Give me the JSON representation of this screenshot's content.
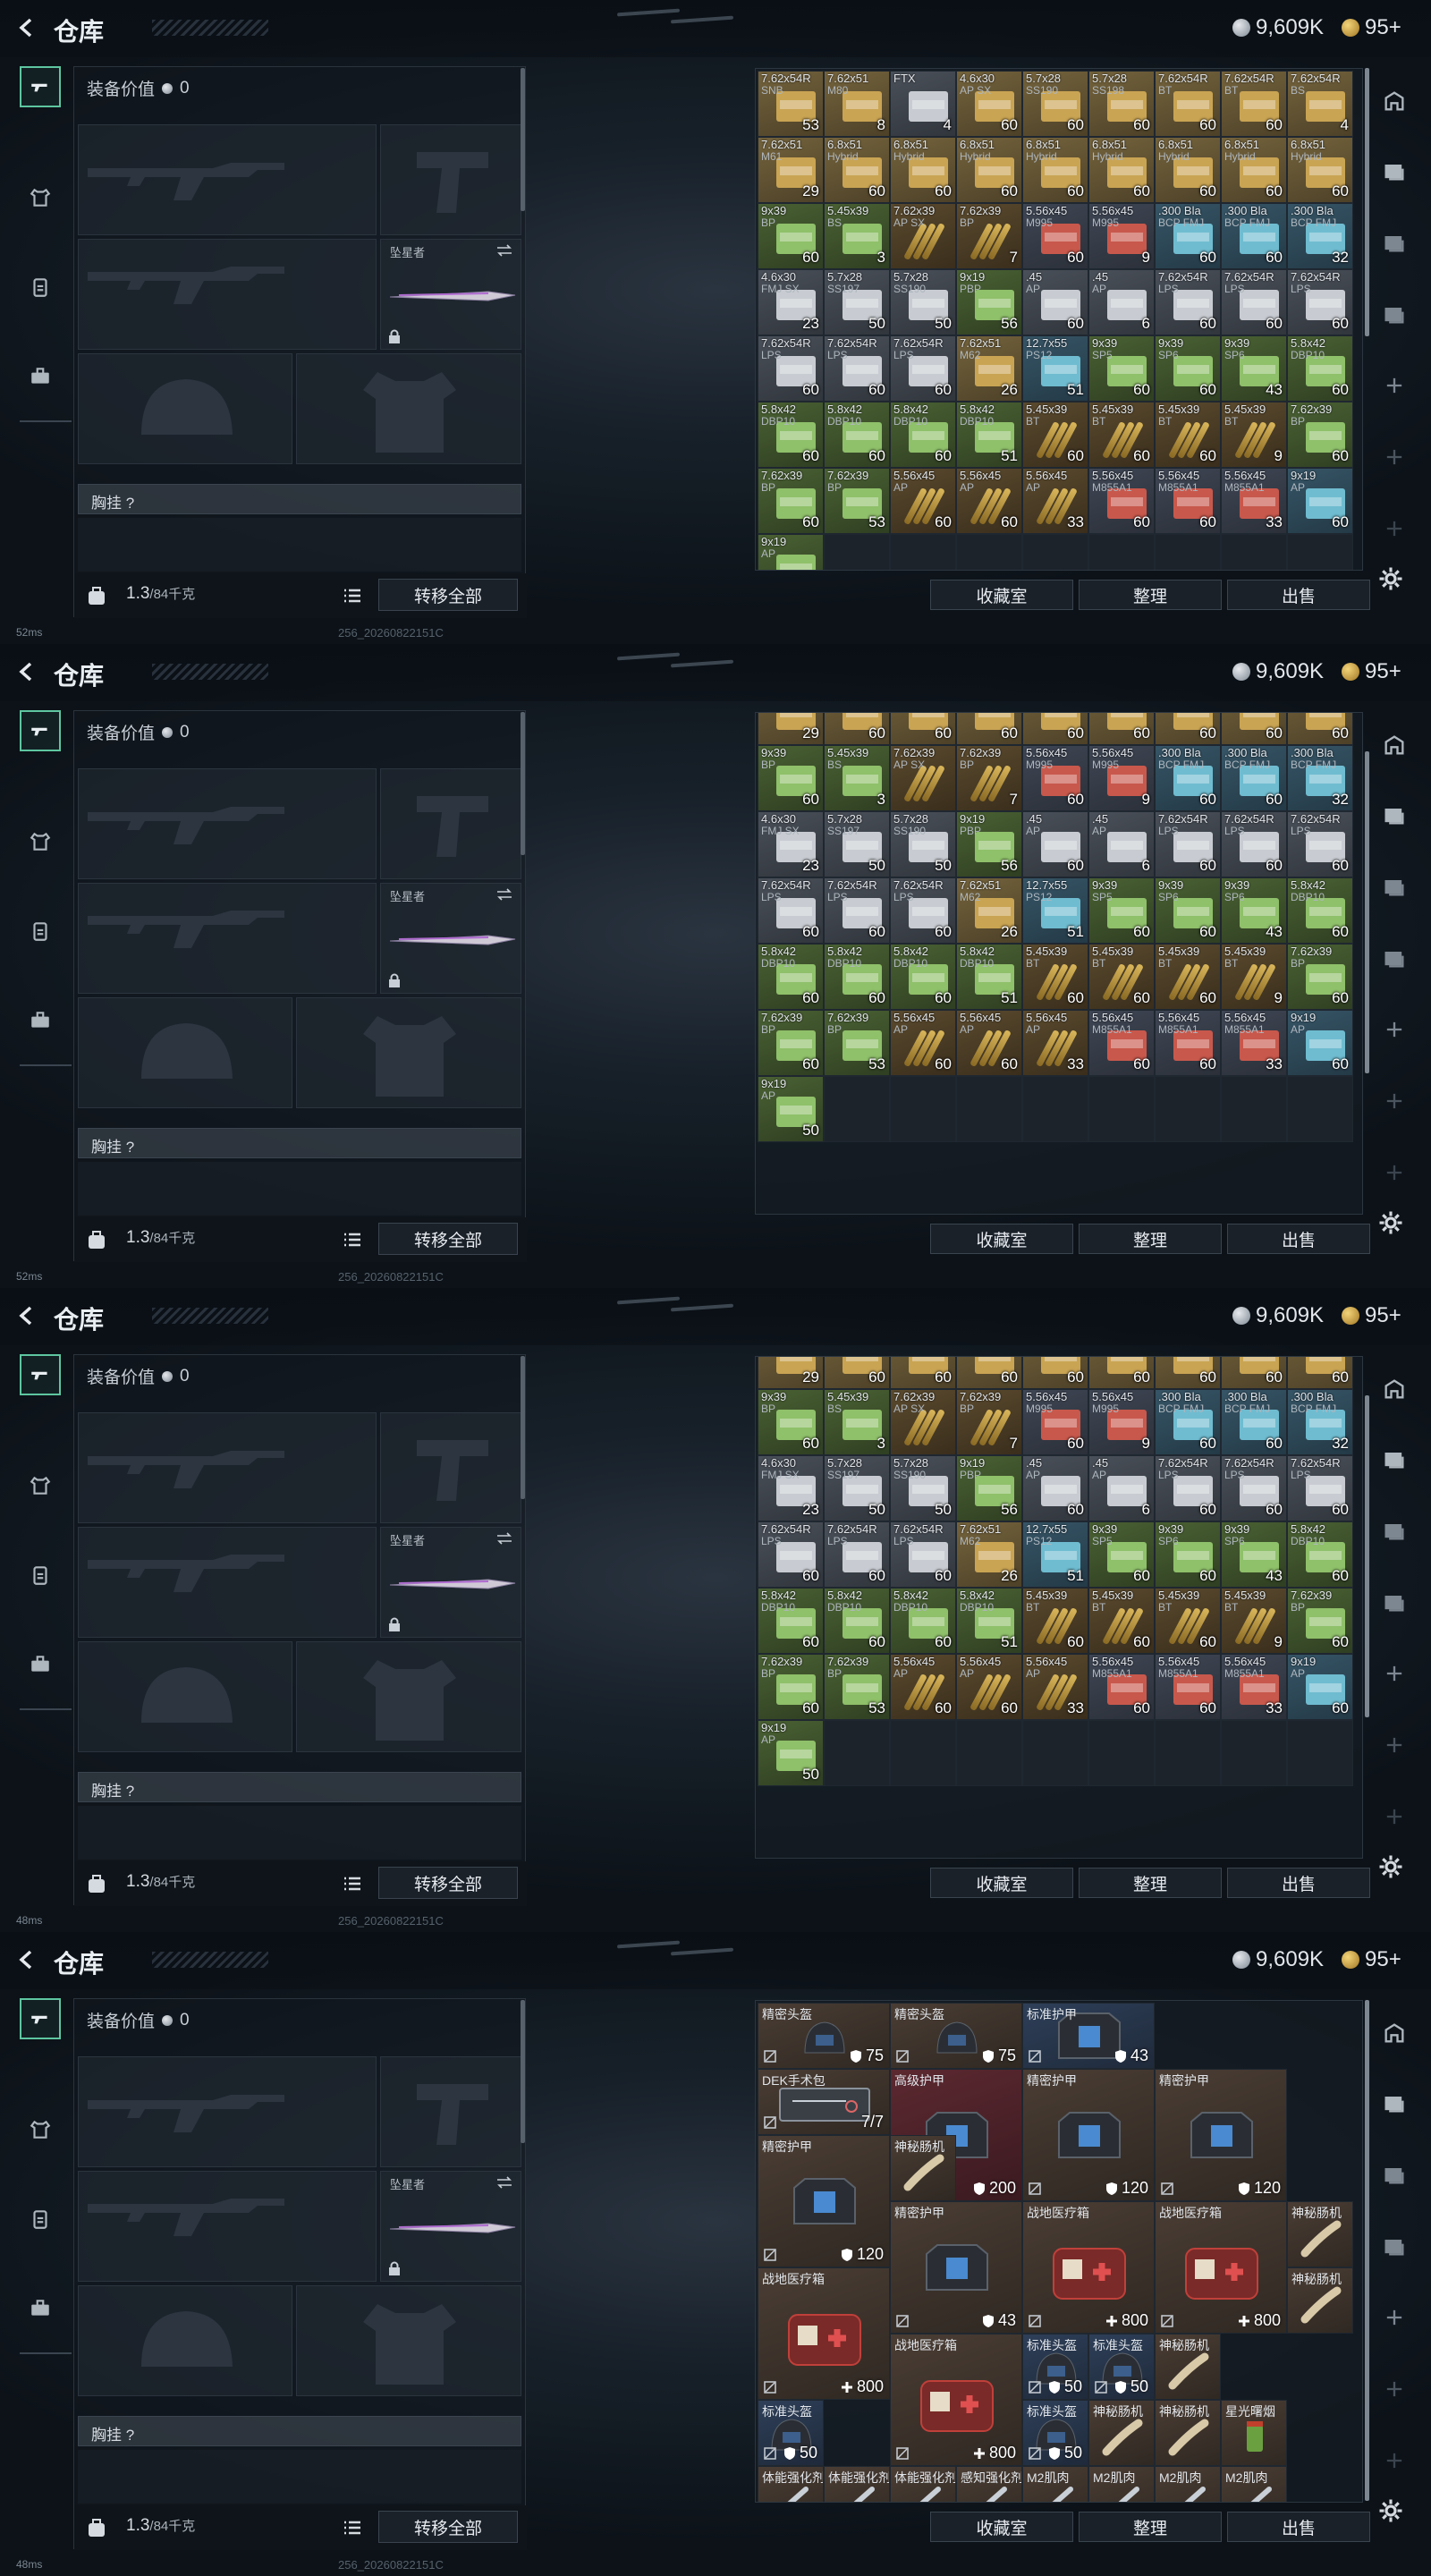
{
  "header": {
    "title": "仓库",
    "silver": "9,609K",
    "gold": "95+"
  },
  "loadout": {
    "value_label": "装备价值",
    "value": "0",
    "melee_name": "坠星者",
    "rig_label": "胸挂 ?",
    "weight": "1.3",
    "weight_max": "/84千克",
    "transfer_all": "转移全部"
  },
  "actions": {
    "collect": "收藏室",
    "sort": "整理",
    "sell": "出售"
  },
  "status": [
    {
      "ping": "52ms",
      "version": "256_20260822151C"
    },
    {
      "ping": "52ms",
      "version": "256_20260822151C"
    },
    {
      "ping": "48ms",
      "version": "256_20260822151C"
    },
    {
      "ping": "48ms",
      "version": "256_20260822151C"
    }
  ],
  "colors": {
    "accent": "#5ec6a0",
    "gold_cell": "#6b5a36",
    "green_cell": "#3e5a34",
    "blue_cell": "#2f4a60",
    "red_cell": "#5a2e2e",
    "grey_cell": "#3c434c"
  },
  "ammo_grid": [
    [
      {
        "n": "7.62x54R",
        "s": "SNB",
        "c": "53",
        "t": "g"
      },
      {
        "n": "7.62x51",
        "s": "M80",
        "c": "8",
        "t": "g"
      },
      {
        "n": "FTX",
        "s": "",
        "c": "4",
        "t": "s"
      },
      {
        "n": "4.6x30",
        "s": "AP SX",
        "c": "60",
        "t": "g"
      },
      {
        "n": "5.7x28",
        "s": "SS190",
        "c": "60",
        "t": "g"
      },
      {
        "n": "5.7x28",
        "s": "SS198",
        "c": "60",
        "t": "g"
      },
      {
        "n": "7.62x54R",
        "s": "BT",
        "c": "60",
        "t": "g"
      },
      {
        "n": "7.62x54R",
        "s": "BT",
        "c": "60",
        "t": "g"
      },
      {
        "n": "7.62x54R",
        "s": "BS",
        "c": "4",
        "t": "g"
      }
    ],
    [
      {
        "n": "7.62x51",
        "s": "M61",
        "c": "29",
        "t": "g"
      },
      {
        "n": "6.8x51",
        "s": "Hybrid",
        "c": "60",
        "t": "g"
      },
      {
        "n": "6.8x51",
        "s": "Hybrid",
        "c": "60",
        "t": "g"
      },
      {
        "n": "6.8x51",
        "s": "Hybrid",
        "c": "60",
        "t": "g"
      },
      {
        "n": "6.8x51",
        "s": "Hybrid",
        "c": "60",
        "t": "g"
      },
      {
        "n": "6.8x51",
        "s": "Hybrid",
        "c": "60",
        "t": "g"
      },
      {
        "n": "6.8x51",
        "s": "Hybrid",
        "c": "60",
        "t": "g"
      },
      {
        "n": "6.8x51",
        "s": "Hybrid",
        "c": "60",
        "t": "g"
      },
      {
        "n": "6.8x51",
        "s": "Hybrid",
        "c": "60",
        "t": "g"
      }
    ],
    [
      {
        "n": "9x39",
        "s": "BP",
        "c": "60",
        "t": "n"
      },
      {
        "n": "5.45x39",
        "s": "BS",
        "c": "3",
        "t": "n"
      },
      {
        "n": "7.62x39",
        "s": "AP SX",
        "c": "",
        "t": "r"
      },
      {
        "n": "7.62x39",
        "s": "BP",
        "c": "7",
        "t": "r"
      },
      {
        "n": "5.56x45",
        "s": "M995",
        "c": "60",
        "t": "e"
      },
      {
        "n": "5.56x45",
        "s": "M995",
        "c": "9",
        "t": "e"
      },
      {
        "n": ".300 Bla",
        "s": "BCP FMJ",
        "c": "60",
        "t": "b"
      },
      {
        "n": ".300 Bla",
        "s": "BCP FMJ",
        "c": "60",
        "t": "b"
      },
      {
        "n": ".300 Bla",
        "s": "BCP FMJ",
        "c": "32",
        "t": "b"
      }
    ],
    [
      {
        "n": "4.6x30",
        "s": "FMJ SX",
        "c": "23",
        "t": "s"
      },
      {
        "n": "5.7x28",
        "s": "SS197",
        "c": "50",
        "t": "s"
      },
      {
        "n": "5.7x28",
        "s": "SS190",
        "c": "50",
        "t": "s"
      },
      {
        "n": "9x19",
        "s": "PBP",
        "c": "56",
        "t": "n"
      },
      {
        "n": ".45",
        "s": "AP",
        "c": "60",
        "t": "s"
      },
      {
        "n": ".45",
        "s": "AP",
        "c": "6",
        "t": "s"
      },
      {
        "n": "7.62x54R",
        "s": "LPS",
        "c": "60",
        "t": "s"
      },
      {
        "n": "7.62x54R",
        "s": "LPS",
        "c": "60",
        "t": "s"
      },
      {
        "n": "7.62x54R",
        "s": "LPS",
        "c": "60",
        "t": "s"
      }
    ],
    [
      {
        "n": "7.62x54R",
        "s": "LPS",
        "c": "60",
        "t": "s"
      },
      {
        "n": "7.62x54R",
        "s": "LPS",
        "c": "60",
        "t": "s"
      },
      {
        "n": "7.62x54R",
        "s": "LPS",
        "c": "60",
        "t": "s"
      },
      {
        "n": "7.62x51",
        "s": "M62",
        "c": "26",
        "t": "g"
      },
      {
        "n": "12.7x55",
        "s": "PS12",
        "c": "51",
        "t": "b"
      },
      {
        "n": "9x39",
        "s": "SP5",
        "c": "60",
        "t": "n"
      },
      {
        "n": "9x39",
        "s": "SP6",
        "c": "60",
        "t": "n"
      },
      {
        "n": "9x39",
        "s": "SP6",
        "c": "43",
        "t": "n"
      },
      {
        "n": "5.8x42",
        "s": "DBP10",
        "c": "60",
        "t": "n"
      }
    ],
    [
      {
        "n": "5.8x42",
        "s": "DBP10",
        "c": "60",
        "t": "n"
      },
      {
        "n": "5.8x42",
        "s": "DBP10",
        "c": "60",
        "t": "n"
      },
      {
        "n": "5.8x42",
        "s": "DBP10",
        "c": "60",
        "t": "n"
      },
      {
        "n": "5.8x42",
        "s": "DBP10",
        "c": "51",
        "t": "n"
      },
      {
        "n": "5.45x39",
        "s": "BT",
        "c": "60",
        "t": "r"
      },
      {
        "n": "5.45x39",
        "s": "BT",
        "c": "60",
        "t": "r"
      },
      {
        "n": "5.45x39",
        "s": "BT",
        "c": "60",
        "t": "r"
      },
      {
        "n": "5.45x39",
        "s": "BT",
        "c": "9",
        "t": "r"
      },
      {
        "n": "7.62x39",
        "s": "BP",
        "c": "60",
        "t": "n"
      }
    ],
    [
      {
        "n": "7.62x39",
        "s": "BP",
        "c": "60",
        "t": "n"
      },
      {
        "n": "7.62x39",
        "s": "BP",
        "c": "53",
        "t": "n"
      },
      {
        "n": "5.56x45",
        "s": "AP",
        "c": "60",
        "t": "r"
      },
      {
        "n": "5.56x45",
        "s": "AP",
        "c": "60",
        "t": "r"
      },
      {
        "n": "5.56x45",
        "s": "AP",
        "c": "33",
        "t": "r"
      },
      {
        "n": "5.56x45",
        "s": "M855A1",
        "c": "60",
        "t": "e"
      },
      {
        "n": "5.56x45",
        "s": "M855A1",
        "c": "60",
        "t": "e"
      },
      {
        "n": "5.56x45",
        "s": "M855A1",
        "c": "33",
        "t": "e"
      },
      {
        "n": "9x19",
        "s": "AP",
        "c": "60",
        "t": "b"
      }
    ],
    [
      {
        "n": "9x19",
        "s": "AP",
        "c": "50",
        "t": "n"
      }
    ]
  ],
  "partial_row": [
    "29",
    "60",
    "60",
    "60",
    "60",
    "60",
    "60",
    "60",
    "60"
  ],
  "gear_items": [
    {
      "name": "精密头盔",
      "val": "75",
      "kind": "helmet",
      "r": 0,
      "c": 0,
      "w": 2,
      "h": 1,
      "bg": "brown",
      "stat": "shield"
    },
    {
      "name": "精密头盔",
      "val": "75",
      "kind": "helmet",
      "r": 0,
      "c": 2,
      "w": 2,
      "h": 1,
      "bg": "brown",
      "stat": "shield"
    },
    {
      "name": "标准护甲",
      "val": "43",
      "kind": "vest",
      "r": 0,
      "c": 4,
      "w": 2,
      "h": 1,
      "bg": "blue",
      "stat": "shield"
    },
    {
      "name": "DEK手术包",
      "val": "7/7",
      "kind": "surgery",
      "r": 1,
      "c": 0,
      "w": 2,
      "h": 1,
      "bg": "brown",
      "stat": "none"
    },
    {
      "name": "高级护甲",
      "val": "200",
      "kind": "vest",
      "r": 1,
      "c": 2,
      "w": 2,
      "h": 2,
      "bg": "red",
      "stat": "shield"
    },
    {
      "name": "精密护甲",
      "val": "120",
      "kind": "vest",
      "r": 1,
      "c": 4,
      "w": 2,
      "h": 2,
      "bg": "brown",
      "stat": "shield"
    },
    {
      "name": "精密护甲",
      "val": "120",
      "kind": "vest",
      "r": 1,
      "c": 6,
      "w": 2,
      "h": 2,
      "bg": "brown",
      "stat": "shield"
    },
    {
      "name": "精密护甲",
      "val": "120",
      "kind": "vest",
      "r": 2,
      "c": 0,
      "w": 2,
      "h": 2,
      "bg": "brown",
      "stat": "shield"
    },
    {
      "name": "神秘肠机",
      "val": "",
      "kind": "tube",
      "r": 2,
      "c": 2,
      "w": 1,
      "h": 1,
      "bg": "brown",
      "stat": "none"
    },
    {
      "name": "精密护甲",
      "val": "43",
      "kind": "vest",
      "r": 3,
      "c": 2,
      "w": 2,
      "h": 2,
      "bg": "brown",
      "stat": "shield"
    },
    {
      "name": "战地医疗箱",
      "val": "800",
      "kind": "med",
      "r": 3,
      "c": 4,
      "w": 2,
      "h": 2,
      "bg": "brown",
      "stat": "plus"
    },
    {
      "name": "战地医疗箱",
      "val": "800",
      "kind": "med",
      "r": 3,
      "c": 6,
      "w": 2,
      "h": 2,
      "bg": "brown",
      "stat": "plus"
    },
    {
      "name": "神秘肠机",
      "val": "",
      "kind": "tube",
      "r": 3,
      "c": 8,
      "w": 1,
      "h": 1,
      "bg": "brown",
      "stat": "none"
    },
    {
      "name": "战地医疗箱",
      "val": "800",
      "kind": "med",
      "r": 4,
      "c": 0,
      "w": 2,
      "h": 2,
      "bg": "brown",
      "stat": "plus"
    },
    {
      "name": "神秘肠机",
      "val": "",
      "kind": "tube",
      "r": 4,
      "c": 8,
      "w": 1,
      "h": 1,
      "bg": "brown",
      "stat": "none"
    },
    {
      "name": "战地医疗箱",
      "val": "800",
      "kind": "med",
      "r": 5,
      "c": 2,
      "w": 2,
      "h": 2,
      "bg": "brown",
      "stat": "plus"
    },
    {
      "name": "标准头盔",
      "val": "50",
      "kind": "helmet",
      "r": 5,
      "c": 4,
      "w": 1,
      "h": 1,
      "bg": "blue",
      "stat": "shield"
    },
    {
      "name": "标准头盔",
      "val": "50",
      "kind": "helmet",
      "r": 5,
      "c": 5,
      "w": 1,
      "h": 1,
      "bg": "blue",
      "stat": "shield"
    },
    {
      "name": "神秘肠机",
      "val": "",
      "kind": "tube",
      "r": 5,
      "c": 6,
      "w": 1,
      "h": 1,
      "bg": "brown",
      "stat": "none"
    },
    {
      "name": "标准头盔",
      "val": "50",
      "kind": "helmet",
      "r": 6,
      "c": 0,
      "w": 1,
      "h": 1,
      "bg": "blue",
      "stat": "shield"
    },
    {
      "name": "标准头盔",
      "val": "50",
      "kind": "helmet",
      "r": 6,
      "c": 4,
      "w": 1,
      "h": 1,
      "bg": "blue",
      "stat": "shield"
    },
    {
      "name": "神秘肠机",
      "val": "",
      "kind": "tube",
      "r": 6,
      "c": 5,
      "w": 1,
      "h": 1,
      "bg": "brown",
      "stat": "none"
    },
    {
      "name": "神秘肠机",
      "val": "",
      "kind": "tube",
      "r": 6,
      "c": 6,
      "w": 1,
      "h": 1,
      "bg": "brown",
      "stat": "none"
    },
    {
      "name": "星光曙烟",
      "val": "",
      "kind": "smoke",
      "r": 6,
      "c": 7,
      "w": 1,
      "h": 1,
      "bg": "brown",
      "stat": "none"
    },
    {
      "name": "体能强化剂",
      "val": "",
      "kind": "syringe",
      "r": 7,
      "c": 0,
      "w": 1,
      "h": 1,
      "bg": "brown",
      "stat": "none"
    },
    {
      "name": "体能强化剂",
      "val": "",
      "kind": "syringe",
      "r": 7,
      "c": 1,
      "w": 1,
      "h": 1,
      "bg": "brown",
      "stat": "none"
    },
    {
      "name": "体能强化剂",
      "val": "",
      "kind": "syringe",
      "r": 7,
      "c": 2,
      "w": 1,
      "h": 1,
      "bg": "brown",
      "stat": "none"
    },
    {
      "name": "感知强化剂",
      "val": "",
      "kind": "syringe",
      "r": 7,
      "c": 3,
      "w": 1,
      "h": 1,
      "bg": "brown",
      "stat": "none"
    },
    {
      "name": "M2肌肉",
      "val": "",
      "kind": "syringe",
      "r": 7,
      "c": 4,
      "w": 1,
      "h": 1,
      "bg": "brown",
      "stat": "none"
    },
    {
      "name": "M2肌肉",
      "val": "",
      "kind": "syringe",
      "r": 7,
      "c": 5,
      "w": 1,
      "h": 1,
      "bg": "brown",
      "stat": "none"
    },
    {
      "name": "M2肌肉",
      "val": "",
      "kind": "syringe",
      "r": 7,
      "c": 6,
      "w": 1,
      "h": 1,
      "bg": "brown",
      "stat": "none"
    },
    {
      "name": "M2肌肉",
      "val": "",
      "kind": "syringe",
      "r": 7,
      "c": 7,
      "w": 1,
      "h": 1,
      "bg": "brown",
      "stat": "none"
    }
  ],
  "icons": {
    "back": "back-arrow-icon",
    "weapon": "rifle-tab-icon",
    "armor": "armor-tab-icon",
    "rig": "rig-tab-icon",
    "bag": "briefcase-tab-icon",
    "silver": "silver-coin-icon",
    "gold": "gold-coin-icon",
    "settings": "gear-icon"
  }
}
